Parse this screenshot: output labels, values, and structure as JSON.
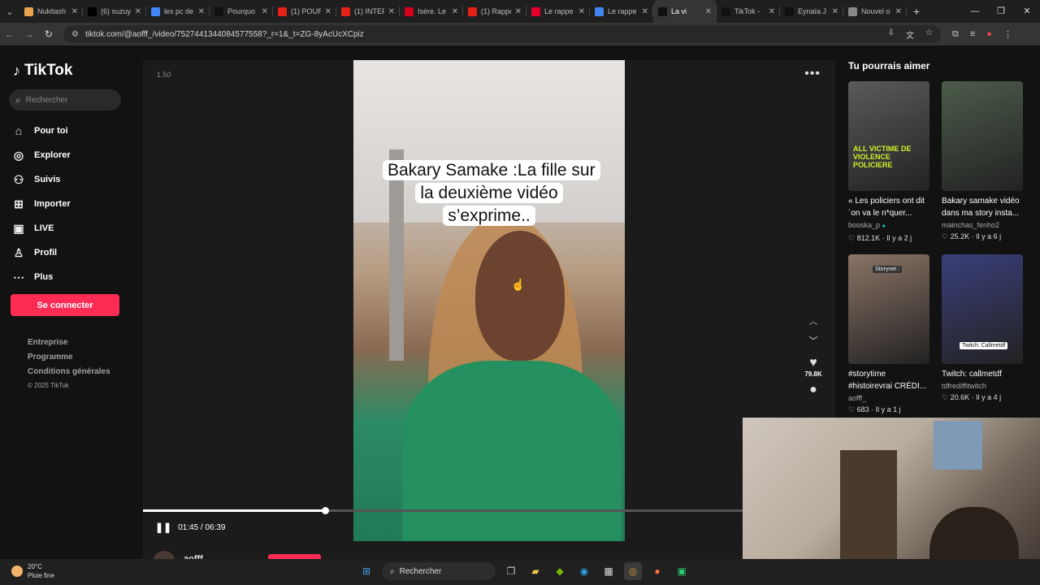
{
  "browser": {
    "tabs": [
      {
        "title": "Nukitash",
        "color": "#e8a44c"
      },
      {
        "title": "(6) suzuy",
        "color": "#000000"
      },
      {
        "title": "les pc de",
        "color": "#4285f4"
      },
      {
        "title": "Pourquo",
        "color": "#111111"
      },
      {
        "title": "(1) POUR",
        "color": "#e62117"
      },
      {
        "title": "(1) INTEF",
        "color": "#e62117"
      },
      {
        "title": "Isère. Le",
        "color": "#d6001c"
      },
      {
        "title": "(1) Rappe",
        "color": "#e62117"
      },
      {
        "title": "Le rappe",
        "color": "#e4002b"
      },
      {
        "title": "Le rappe",
        "color": "#4285f4"
      },
      {
        "title": "La vi",
        "color": "#111111",
        "active": true
      },
      {
        "title": "TikTok -",
        "color": "#111111"
      },
      {
        "title": "Eynaïa J",
        "color": "#111111"
      },
      {
        "title": "Nouvel o",
        "color": "#888888"
      }
    ],
    "url": "tiktok.com/@aofff_/video/7527441344084577558?_r=1&_t=ZG-8yAcUcXCpiz"
  },
  "tiktok": {
    "logo": "TikTok",
    "search_placeholder": "Rechercher",
    "nav": [
      {
        "label": "Pour toi",
        "icon": "home-icon",
        "glyph": "⌂"
      },
      {
        "label": "Explorer",
        "icon": "compass-icon",
        "glyph": "◎"
      },
      {
        "label": "Suivis",
        "icon": "following-icon",
        "glyph": "⚇"
      },
      {
        "label": "Importer",
        "icon": "upload-icon",
        "glyph": "⊞"
      },
      {
        "label": "LIVE",
        "icon": "live-icon",
        "glyph": "▣"
      },
      {
        "label": "Profil",
        "icon": "profile-icon",
        "glyph": "♙"
      },
      {
        "label": "Plus",
        "icon": "more-icon",
        "glyph": "⋯"
      }
    ],
    "login_button": "Se connecter",
    "footer": {
      "links": [
        "Entreprise",
        "Programme",
        "Conditions générales"
      ],
      "copyright": "© 2025 TikTok"
    }
  },
  "player": {
    "speed": "1.50",
    "caption": "Bakary Samake :La fille sur la deuxième vidéo s’exprime..",
    "current_time": "01:45",
    "duration": "06:39",
    "time_display": "01:45 / 06:39",
    "progress": 0.263,
    "likes": "79.8K",
    "author": "aofff"
  },
  "recommendations": {
    "title": "Tu pourrais aimer",
    "items": [
      {
        "title": "« Les policiers ont dit ´on va le n*quer...",
        "author": "booska_p",
        "verified": true,
        "likes": "812.1K",
        "age": "Il y a 2 j",
        "thumb_text": "ALL VICTIME DE VIOLENCE POLICIERE",
        "thumb_color": "#5a5a5a"
      },
      {
        "title": "Bakary samake vidéo dans ma story insta...",
        "author": "mainchas_fenho2",
        "verified": false,
        "likes": "25.2K",
        "age": "Il y a 6 j",
        "thumb_text": "",
        "thumb_color": "#4c5c4a"
      },
      {
        "title": "#storytime #histoirevrai CRÉDI...",
        "author": "aofff_",
        "verified": false,
        "likes": "683",
        "age": "Il y a 1 j",
        "thumb_text": "Storynet :",
        "thumb_color": "#8a7466"
      },
      {
        "title": "Twitch: callmetdf",
        "author": "tdfrediffitwitch",
        "verified": false,
        "likes": "20.6K",
        "age": "Il y a 4 j",
        "thumb_text": "Twitch: Callmetdf",
        "thumb_color": "#3a3f7a"
      }
    ]
  },
  "taskbar": {
    "temperature": "20°C",
    "weather": "Pluie fine",
    "search": "Rechercher"
  }
}
